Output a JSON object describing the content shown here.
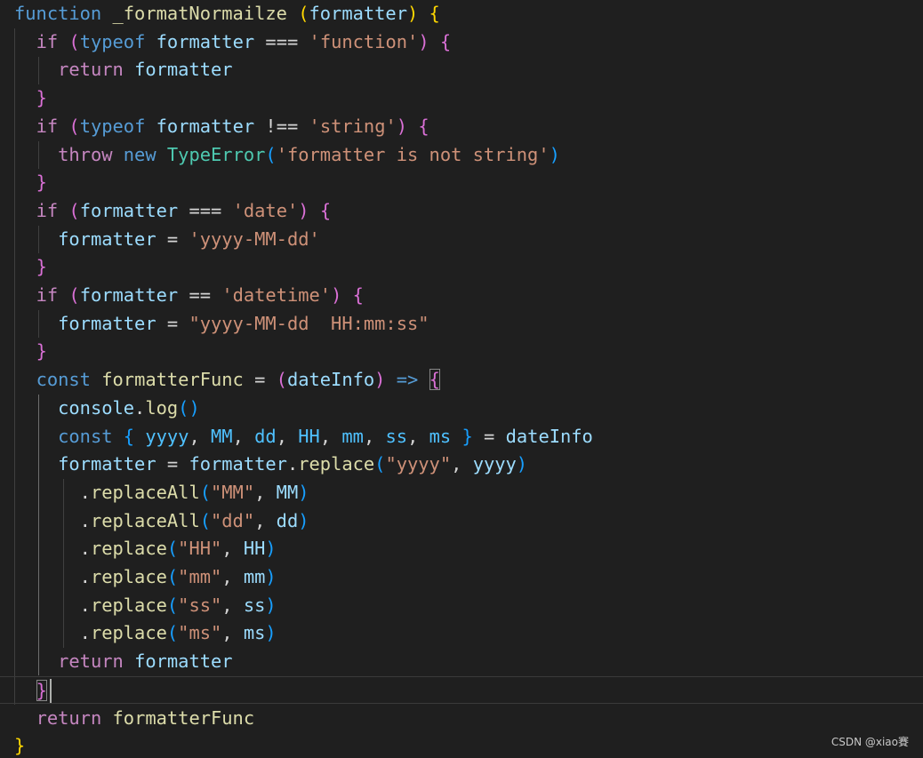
{
  "editor": {
    "theme_colors": {
      "background": "#1f1f1f",
      "keyword": "#569cd6",
      "control_keyword": "#c586c0",
      "variable": "#9cdcfe",
      "function": "#dcdcaa",
      "class": "#4ec9b0",
      "string": "#ce9178",
      "bracket_level_1": "#ffd700",
      "bracket_level_2": "#da70d6",
      "bracket_level_3": "#179fff"
    },
    "lines": [
      [
        [
          "function",
          "kw-blue"
        ],
        [
          " ",
          ""
        ],
        [
          "_formatNormailze",
          "fn"
        ],
        [
          " ",
          ""
        ],
        [
          "(",
          "b1"
        ],
        [
          "formatter",
          "ident"
        ],
        [
          ")",
          "b1"
        ],
        [
          " ",
          ""
        ],
        [
          "{",
          "b1"
        ]
      ],
      [
        [
          "  ",
          ""
        ],
        [
          "if",
          "kw-ctrl"
        ],
        [
          " ",
          ""
        ],
        [
          "(",
          "b2"
        ],
        [
          "typeof",
          "kw-blue"
        ],
        [
          " ",
          ""
        ],
        [
          "formatter",
          "ident"
        ],
        [
          " ",
          ""
        ],
        [
          "===",
          "op"
        ],
        [
          " ",
          ""
        ],
        [
          "'function'",
          "str"
        ],
        [
          ")",
          "b2"
        ],
        [
          " ",
          ""
        ],
        [
          "{",
          "b2"
        ]
      ],
      [
        [
          "    ",
          ""
        ],
        [
          "return",
          "kw-ctrl"
        ],
        [
          " ",
          ""
        ],
        [
          "formatter",
          "ident"
        ]
      ],
      [
        [
          "  ",
          ""
        ],
        [
          "}",
          "b2"
        ]
      ],
      [
        [
          "  ",
          ""
        ],
        [
          "if",
          "kw-ctrl"
        ],
        [
          " ",
          ""
        ],
        [
          "(",
          "b2"
        ],
        [
          "typeof",
          "kw-blue"
        ],
        [
          " ",
          ""
        ],
        [
          "formatter",
          "ident"
        ],
        [
          " ",
          ""
        ],
        [
          "!==",
          "op"
        ],
        [
          " ",
          ""
        ],
        [
          "'string'",
          "str"
        ],
        [
          ")",
          "b2"
        ],
        [
          " ",
          ""
        ],
        [
          "{",
          "b2"
        ]
      ],
      [
        [
          "    ",
          ""
        ],
        [
          "throw",
          "kw-ctrl"
        ],
        [
          " ",
          ""
        ],
        [
          "new",
          "kw-blue"
        ],
        [
          " ",
          ""
        ],
        [
          "TypeError",
          "cls"
        ],
        [
          "(",
          "b3"
        ],
        [
          "'formatter is not string'",
          "str"
        ],
        [
          ")",
          "b3"
        ]
      ],
      [
        [
          "  ",
          ""
        ],
        [
          "}",
          "b2"
        ]
      ],
      [
        [
          "  ",
          ""
        ],
        [
          "if",
          "kw-ctrl"
        ],
        [
          " ",
          ""
        ],
        [
          "(",
          "b2"
        ],
        [
          "formatter",
          "ident"
        ],
        [
          " ",
          ""
        ],
        [
          "===",
          "op"
        ],
        [
          " ",
          ""
        ],
        [
          "'date'",
          "str"
        ],
        [
          ")",
          "b2"
        ],
        [
          " ",
          ""
        ],
        [
          "{",
          "b2"
        ]
      ],
      [
        [
          "    ",
          ""
        ],
        [
          "formatter",
          "ident"
        ],
        [
          " ",
          ""
        ],
        [
          "=",
          "op"
        ],
        [
          " ",
          ""
        ],
        [
          "'yyyy-MM-dd'",
          "str"
        ]
      ],
      [
        [
          "  ",
          ""
        ],
        [
          "}",
          "b2"
        ]
      ],
      [
        [
          "  ",
          ""
        ],
        [
          "if",
          "kw-ctrl"
        ],
        [
          " ",
          ""
        ],
        [
          "(",
          "b2"
        ],
        [
          "formatter",
          "ident"
        ],
        [
          " ",
          ""
        ],
        [
          "==",
          "op"
        ],
        [
          " ",
          ""
        ],
        [
          "'datetime'",
          "str"
        ],
        [
          ")",
          "b2"
        ],
        [
          " ",
          ""
        ],
        [
          "{",
          "b2"
        ]
      ],
      [
        [
          "    ",
          ""
        ],
        [
          "formatter",
          "ident"
        ],
        [
          " ",
          ""
        ],
        [
          "=",
          "op"
        ],
        [
          " ",
          ""
        ],
        [
          "\"yyyy-MM-dd  HH:mm:ss\"",
          "str"
        ]
      ],
      [
        [
          "  ",
          ""
        ],
        [
          "}",
          "b2"
        ]
      ],
      [
        [
          "  ",
          ""
        ],
        [
          "const",
          "kw-blue"
        ],
        [
          " ",
          ""
        ],
        [
          "formatterFunc",
          "fn"
        ],
        [
          " ",
          ""
        ],
        [
          "=",
          "op"
        ],
        [
          " ",
          ""
        ],
        [
          "(",
          "b2"
        ],
        [
          "dateInfo",
          "ident"
        ],
        [
          ")",
          "b2"
        ],
        [
          " ",
          ""
        ],
        [
          "=>",
          "kw-blue"
        ],
        [
          " ",
          ""
        ],
        [
          "{",
          "b2 boxed"
        ]
      ],
      [
        [
          "    ",
          ""
        ],
        [
          "console",
          "ident"
        ],
        [
          ".",
          "punct"
        ],
        [
          "log",
          "fn"
        ],
        [
          "()",
          "b3"
        ]
      ],
      [
        [
          "    ",
          ""
        ],
        [
          "const",
          "kw-blue"
        ],
        [
          " ",
          ""
        ],
        [
          "{",
          "b3"
        ],
        [
          " ",
          ""
        ],
        [
          "yyyy",
          "const"
        ],
        [
          ", ",
          ""
        ],
        [
          "MM",
          "const"
        ],
        [
          ", ",
          ""
        ],
        [
          "dd",
          "const"
        ],
        [
          ", ",
          ""
        ],
        [
          "HH",
          "const"
        ],
        [
          ", ",
          ""
        ],
        [
          "mm",
          "const"
        ],
        [
          ", ",
          ""
        ],
        [
          "ss",
          "const"
        ],
        [
          ", ",
          ""
        ],
        [
          "ms",
          "const"
        ],
        [
          " ",
          ""
        ],
        [
          "}",
          "b3"
        ],
        [
          " ",
          ""
        ],
        [
          "=",
          "op"
        ],
        [
          " ",
          ""
        ],
        [
          "dateInfo",
          "ident"
        ]
      ],
      [
        [
          "    ",
          ""
        ],
        [
          "formatter",
          "ident"
        ],
        [
          " ",
          ""
        ],
        [
          "=",
          "op"
        ],
        [
          " ",
          ""
        ],
        [
          "formatter",
          "ident"
        ],
        [
          ".",
          "punct"
        ],
        [
          "replace",
          "fn"
        ],
        [
          "(",
          "b3"
        ],
        [
          "\"yyyy\"",
          "str"
        ],
        [
          ", ",
          ""
        ],
        [
          "yyyy",
          "ident"
        ],
        [
          ")",
          "b3"
        ]
      ],
      [
        [
          "      ",
          ""
        ],
        [
          ".",
          "punct"
        ],
        [
          "replaceAll",
          "fn"
        ],
        [
          "(",
          "b3"
        ],
        [
          "\"MM\"",
          "str"
        ],
        [
          ", ",
          ""
        ],
        [
          "MM",
          "ident"
        ],
        [
          ")",
          "b3"
        ]
      ],
      [
        [
          "      ",
          ""
        ],
        [
          ".",
          "punct"
        ],
        [
          "replaceAll",
          "fn"
        ],
        [
          "(",
          "b3"
        ],
        [
          "\"dd\"",
          "str"
        ],
        [
          ", ",
          ""
        ],
        [
          "dd",
          "ident"
        ],
        [
          ")",
          "b3"
        ]
      ],
      [
        [
          "      ",
          ""
        ],
        [
          ".",
          "punct"
        ],
        [
          "replace",
          "fn"
        ],
        [
          "(",
          "b3"
        ],
        [
          "\"HH\"",
          "str"
        ],
        [
          ", ",
          ""
        ],
        [
          "HH",
          "ident"
        ],
        [
          ")",
          "b3"
        ]
      ],
      [
        [
          "      ",
          ""
        ],
        [
          ".",
          "punct"
        ],
        [
          "replace",
          "fn"
        ],
        [
          "(",
          "b3"
        ],
        [
          "\"mm\"",
          "str"
        ],
        [
          ", ",
          ""
        ],
        [
          "mm",
          "ident"
        ],
        [
          ")",
          "b3"
        ]
      ],
      [
        [
          "      ",
          ""
        ],
        [
          ".",
          "punct"
        ],
        [
          "replace",
          "fn"
        ],
        [
          "(",
          "b3"
        ],
        [
          "\"ss\"",
          "str"
        ],
        [
          ", ",
          ""
        ],
        [
          "ss",
          "ident"
        ],
        [
          ")",
          "b3"
        ]
      ],
      [
        [
          "      ",
          ""
        ],
        [
          ".",
          "punct"
        ],
        [
          "replace",
          "fn"
        ],
        [
          "(",
          "b3"
        ],
        [
          "\"ms\"",
          "str"
        ],
        [
          ", ",
          ""
        ],
        [
          "ms",
          "ident"
        ],
        [
          ")",
          "b3"
        ]
      ],
      [
        [
          "    ",
          ""
        ],
        [
          "return",
          "kw-ctrl"
        ],
        [
          " ",
          ""
        ],
        [
          "formatter",
          "ident"
        ]
      ],
      [
        [
          "  ",
          ""
        ],
        [
          "}",
          "b2 boxed"
        ]
      ],
      [
        [
          "  ",
          ""
        ],
        [
          "return",
          "kw-ctrl"
        ],
        [
          " ",
          ""
        ],
        [
          "formatterFunc",
          "fn"
        ]
      ],
      [
        [
          "}",
          "b1"
        ]
      ]
    ]
  },
  "watermark": "CSDN @xiao賽"
}
